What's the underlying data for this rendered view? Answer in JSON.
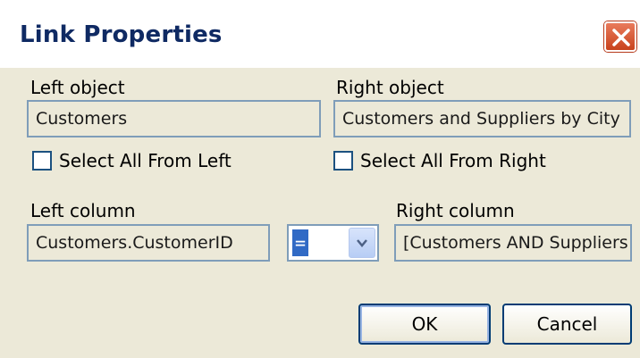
{
  "window": {
    "title": "Link Properties"
  },
  "left_object": {
    "label": "Left object",
    "value": "Customers"
  },
  "right_object": {
    "label": "Right object",
    "value": "Customers and Suppliers by City"
  },
  "select_all_left": {
    "label": "Select All From Left",
    "checked": false
  },
  "select_all_right": {
    "label": "Select All From Right",
    "checked": false
  },
  "left_column": {
    "label": "Left column",
    "value": "Customers.CustomerID"
  },
  "operator": {
    "value": "="
  },
  "right_column": {
    "label": "Right column",
    "value": "[Customers AND Suppliers"
  },
  "buttons": {
    "ok": "OK",
    "cancel": "Cancel"
  }
}
